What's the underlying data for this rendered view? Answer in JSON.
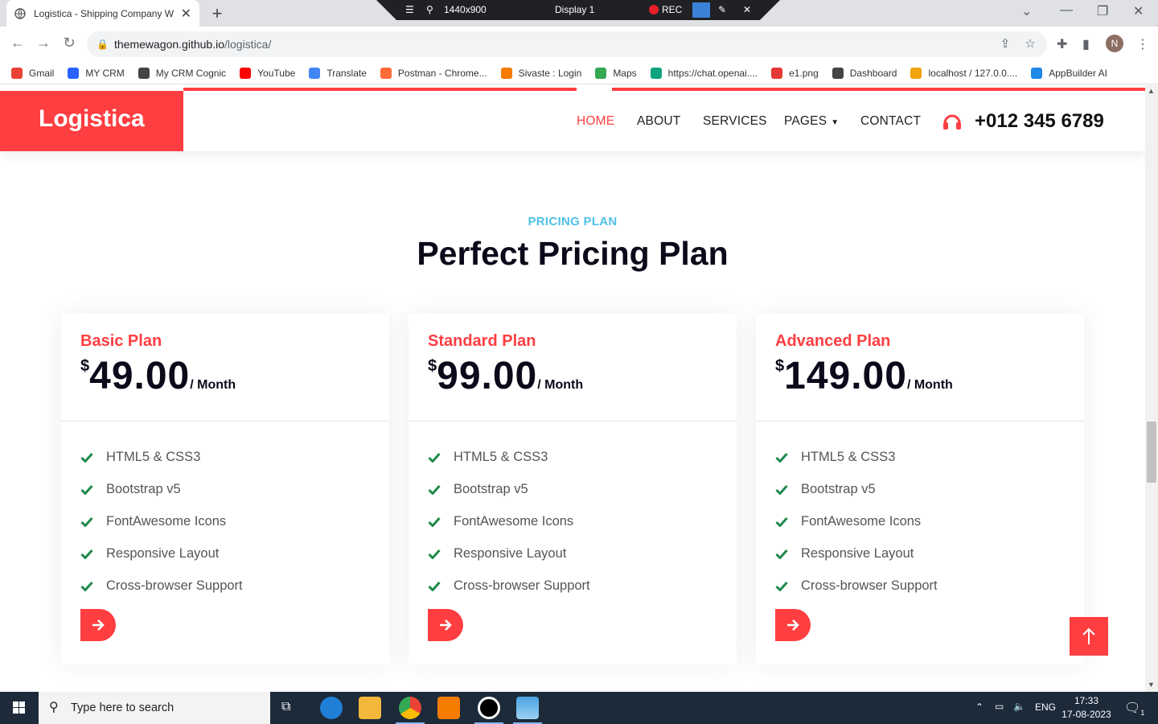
{
  "browser": {
    "tab_title": "Logistica - Shipping Company W",
    "tab_close": "✕",
    "new_tab": "+",
    "url_host": "themewagon.github.io",
    "url_path": "/logistica/",
    "profile_initial": "N"
  },
  "recorder": {
    "resolution": "1440x900",
    "display": "Display 1",
    "rec_label": "REC"
  },
  "bookmarks": [
    {
      "label": "Gmail",
      "color": "#ea4335"
    },
    {
      "label": "MY CRM",
      "color": "#2962ff"
    },
    {
      "label": "My CRM Cognic",
      "color": "#444444"
    },
    {
      "label": "YouTube",
      "color": "#ff0000"
    },
    {
      "label": "Translate",
      "color": "#4285f4"
    },
    {
      "label": "Postman - Chrome...",
      "color": "#ff6c37"
    },
    {
      "label": "Sivaste : Login",
      "color": "#f57c00"
    },
    {
      "label": "Maps",
      "color": "#34a853"
    },
    {
      "label": "https://chat.openai....",
      "color": "#10a37f"
    },
    {
      "label": "e1.png",
      "color": "#e53935"
    },
    {
      "label": "Dashboard",
      "color": "#444444"
    },
    {
      "label": "localhost / 127.0.0....",
      "color": "#f0a30a"
    },
    {
      "label": "AppBuilder AI",
      "color": "#1e88e5"
    }
  ],
  "site": {
    "brand": "Logistica",
    "accent_color": "#ff3e41",
    "nav": {
      "home": "HOME",
      "about": "ABOUT",
      "services": "SERVICES",
      "pages": "PAGES",
      "contact": "CONTACT"
    },
    "phone": "+012 345 6789"
  },
  "pricing": {
    "label": "PRICING PLAN",
    "title": "Perfect Pricing Plan",
    "currency": "$",
    "period": "/ Month",
    "plans": [
      {
        "name": "Basic Plan",
        "price": "49.00",
        "features": [
          "HTML5 & CSS3",
          "Bootstrap v5",
          "FontAwesome Icons",
          "Responsive Layout",
          "Cross-browser Support"
        ]
      },
      {
        "name": "Standard Plan",
        "price": "99.00",
        "features": [
          "HTML5 & CSS3",
          "Bootstrap v5",
          "FontAwesome Icons",
          "Responsive Layout",
          "Cross-browser Support"
        ]
      },
      {
        "name": "Advanced Plan",
        "price": "149.00",
        "features": [
          "HTML5 & CSS3",
          "Bootstrap v5",
          "FontAwesome Icons",
          "Responsive Layout",
          "Cross-browser Support"
        ]
      }
    ]
  },
  "taskbar": {
    "search_placeholder": "Type here to search",
    "language": "ENG",
    "time": "17:33",
    "date": "17-08-2023",
    "notification_count": "1"
  }
}
